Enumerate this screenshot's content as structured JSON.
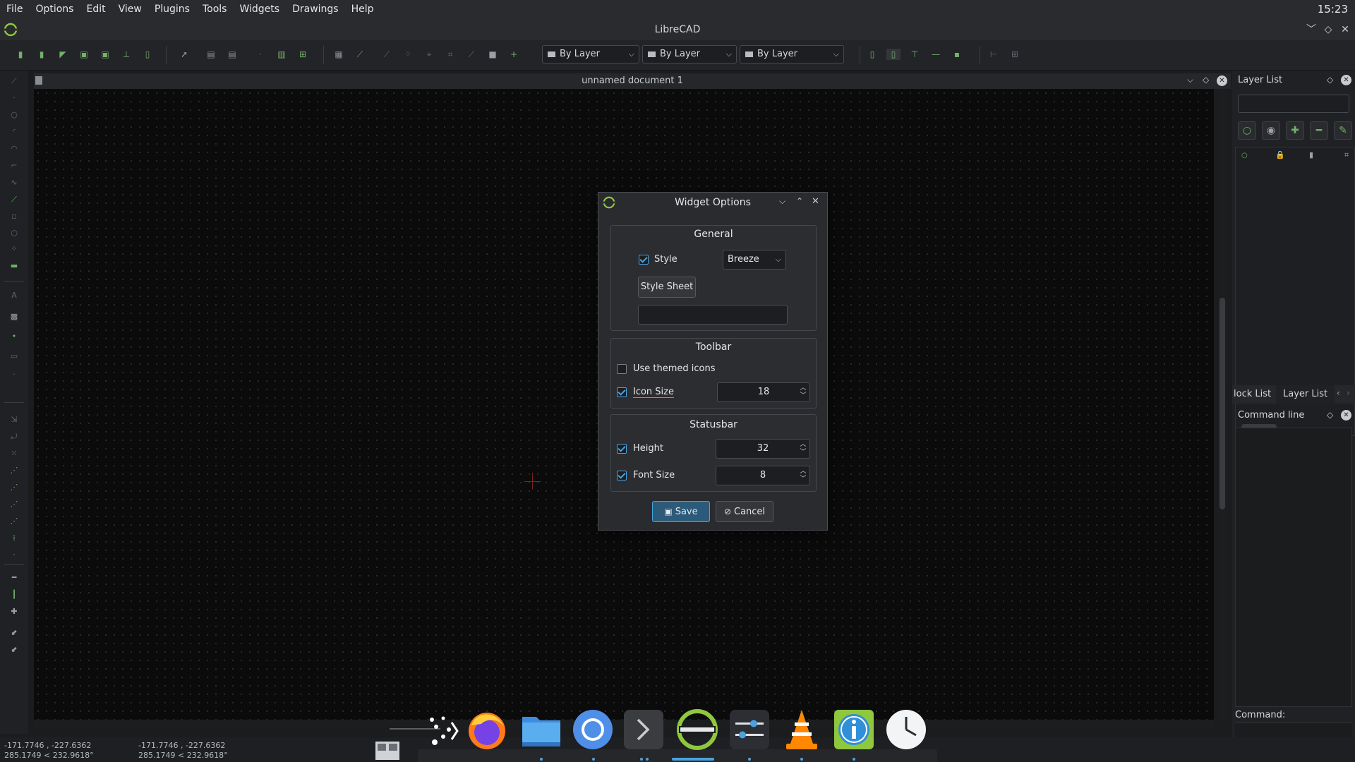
{
  "menubar": {
    "items": [
      "File",
      "Options",
      "Edit",
      "View",
      "Plugins",
      "Tools",
      "Widgets",
      "Drawings",
      "Help"
    ],
    "clock": "15:23"
  },
  "window": {
    "title": "LibreCAD",
    "controls": {
      "minimize": "﹀",
      "restore": "◇",
      "close": "✕"
    }
  },
  "toolbar": {
    "pen_color": "By Layer",
    "line_type": "By Layer",
    "line_width": "By Layer"
  },
  "document": {
    "title": "unnamed document 1"
  },
  "layer_panel": {
    "title": "Layer List",
    "filter_value": ""
  },
  "dock_tabs": {
    "tab1": "lock List",
    "tab2": "Layer List"
  },
  "command_panel": {
    "title": "Command line",
    "prompt": "Command:"
  },
  "statusbar": {
    "abs_coord": "-171.7746 , -227.6362",
    "abs_polar": "285.1749 < 232.9618°",
    "rel_coord": "-171.7746 , -227.6362",
    "rel_polar": "285.1749 < 232.9618°"
  },
  "dialog": {
    "title": "Widget Options",
    "general": {
      "title": "General",
      "style_label": "Style",
      "style_checked": true,
      "style_value": "Breeze",
      "stylesheet_button": "Style Sheet",
      "stylesheet_path": ""
    },
    "toolbar": {
      "title": "Toolbar",
      "themed_icons_label": "Use themed icons",
      "themed_icons_checked": false,
      "icon_size_label": "Icon Size",
      "icon_size_checked": true,
      "icon_size_value": "18"
    },
    "statusbar": {
      "title": "Statusbar",
      "height_label": "Height",
      "height_checked": true,
      "height_value": "32",
      "font_size_label": "Font Size",
      "font_size_checked": true,
      "font_size_value": "8"
    },
    "save_label": "Save",
    "cancel_label": "Cancel"
  },
  "taskbar": {
    "apps": [
      "app-launcher",
      "firefox",
      "files",
      "chromium",
      "terminal",
      "librecad",
      "settings",
      "vlc",
      "info",
      "clock"
    ]
  },
  "colors": {
    "accent": "#4aa3df",
    "tool_green": "#6fb069",
    "canvas": "#0b0b0b"
  }
}
